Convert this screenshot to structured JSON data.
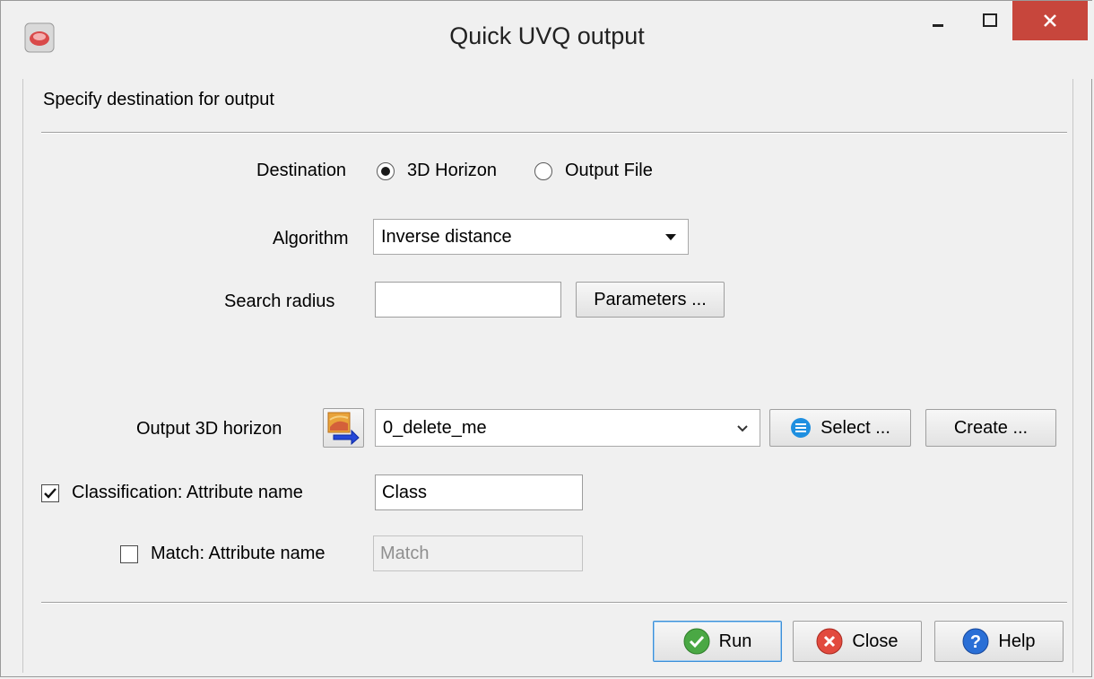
{
  "window": {
    "title": "Quick UVQ output",
    "minimize_glyph": "–",
    "maximize_glyph": "□",
    "close_glyph": "✕"
  },
  "header": {
    "instruction": "Specify destination for output"
  },
  "destination": {
    "label": "Destination",
    "options": [
      {
        "label": "3D Horizon",
        "selected": true
      },
      {
        "label": "Output File",
        "selected": false
      }
    ]
  },
  "algorithm": {
    "label": "Algorithm",
    "value": "Inverse distance"
  },
  "search_radius": {
    "label": "Search radius",
    "value": "",
    "params_button": "Parameters ..."
  },
  "output_horizon": {
    "label": "Output 3D horizon",
    "value": "0_delete_me",
    "select_button": "Select ...",
    "create_button": "Create ..."
  },
  "classification": {
    "checked": true,
    "label": "Classification: Attribute name",
    "value": "Class"
  },
  "match": {
    "checked": false,
    "label": "Match: Attribute name",
    "value": "Match"
  },
  "footer": {
    "run": "Run",
    "close": "Close",
    "help": "Help"
  },
  "colors": {
    "close_button_red": "#c7463c",
    "focus_blue": "#3c8fd8"
  }
}
